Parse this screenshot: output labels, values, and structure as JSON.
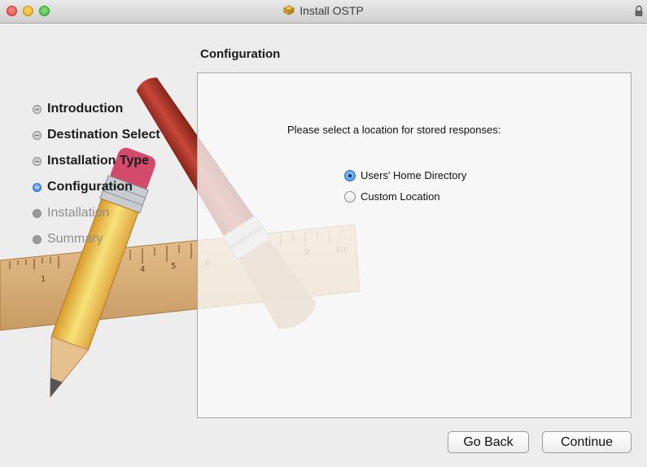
{
  "window": {
    "title": "Install OSTP"
  },
  "heading": "Configuration",
  "steps": [
    {
      "label": "Introduction",
      "state": "done"
    },
    {
      "label": "Destination Select",
      "state": "done"
    },
    {
      "label": "Installation Type",
      "state": "done"
    },
    {
      "label": "Configuration",
      "state": "current"
    },
    {
      "label": "Installation",
      "state": "future"
    },
    {
      "label": "Summary",
      "state": "future"
    }
  ],
  "panel": {
    "prompt": "Please select a location for stored responses:",
    "options": [
      {
        "label": "Users' Home Directory",
        "selected": true
      },
      {
        "label": "Custom Location",
        "selected": false
      }
    ]
  },
  "buttons": {
    "back": "Go Back",
    "continue": "Continue"
  },
  "icons": {
    "title": "package-icon",
    "lock": "lock-icon",
    "background": "installer-pencil-brush-ruler-art"
  },
  "colors": {
    "accent": "#3b7ee8",
    "window_bg": "#ededed"
  },
  "ruler_numbers": [
    "1",
    "4",
    "5",
    "6",
    "9",
    "10"
  ]
}
